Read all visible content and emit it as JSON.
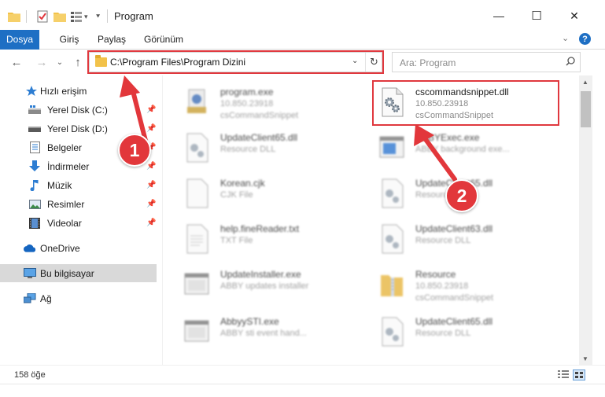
{
  "window": {
    "title": "Program",
    "minimize_glyph": "—",
    "maximize_glyph": "☐",
    "close_glyph": "✕"
  },
  "ribbon": {
    "tabs": [
      "Dosya",
      "Giriş",
      "Paylaş",
      "Görünüm"
    ],
    "active_tab": "Dosya",
    "help_glyph": "?",
    "collapse_glyph": "⌄"
  },
  "navigation": {
    "back_glyph": "←",
    "forward_glyph": "→",
    "recent_glyph": "⌄",
    "up_glyph": "↑",
    "address_path": "C:\\Program Files\\Program Dizini",
    "address_dropdown_glyph": "⌄",
    "refresh_glyph": "↻",
    "search_placeholder": "Ara: Program"
  },
  "sidebar": {
    "items": [
      {
        "label": "Hızlı erişim",
        "icon": "star-icon",
        "pinned": false
      },
      {
        "label": "Yerel Disk (C:)",
        "icon": "drive-icon",
        "pinned": true
      },
      {
        "label": "Yerel Disk (D:)",
        "icon": "drive-icon",
        "pinned": true
      },
      {
        "label": "Belgeler",
        "icon": "documents-icon",
        "pinned": true
      },
      {
        "label": "İndirmeler",
        "icon": "download-icon",
        "pinned": true
      },
      {
        "label": "Müzik",
        "icon": "music-icon",
        "pinned": true
      },
      {
        "label": "Resimler",
        "icon": "pictures-icon",
        "pinned": true
      },
      {
        "label": "Videolar",
        "icon": "video-icon",
        "pinned": true
      },
      {
        "label": "OneDrive",
        "icon": "cloud-icon",
        "pinned": false
      },
      {
        "label": "Bu bilgisayar",
        "icon": "computer-icon",
        "pinned": false
      },
      {
        "label": "Ağ",
        "icon": "network-icon",
        "pinned": false
      }
    ],
    "selected": "Bu bilgisayar"
  },
  "files": [
    {
      "name": "program.exe",
      "line2": "10.850.23918",
      "line3": "csCommandSnippet",
      "icon": "app-icon",
      "column": 0,
      "row": 0,
      "blurred": true
    },
    {
      "name": "cscommandsnippet.dll",
      "line2": "10.850.23918",
      "line3": "csCommandSnippet",
      "icon": "dll-gear-icon",
      "column": 1,
      "row": 0,
      "blurred": false
    },
    {
      "name": "UpdateClient65.dll",
      "line2": "Resource DLL",
      "line3": "",
      "icon": "dll-gear-icon",
      "column": 0,
      "row": 1,
      "blurred": true
    },
    {
      "name": "ABBYExec.exe",
      "line2": "ABBY background exe...",
      "line3": "",
      "icon": "window-app-icon",
      "column": 1,
      "row": 1,
      "blurred": true
    },
    {
      "name": "Korean.cjk",
      "line2": "CJK File",
      "line3": "",
      "icon": "blank-file-icon",
      "column": 0,
      "row": 2,
      "blurred": true
    },
    {
      "name": "UpdateClient65.dll",
      "line2": "Resource DLL",
      "line3": "",
      "icon": "dll-gear-icon",
      "column": 1,
      "row": 2,
      "blurred": true
    },
    {
      "name": "help.fineReader.txt",
      "line2": "TXT File",
      "line3": "",
      "icon": "text-file-icon",
      "column": 0,
      "row": 3,
      "blurred": true
    },
    {
      "name": "UpdateClient63.dll",
      "line2": "Resource DLL",
      "line3": "",
      "icon": "dll-gear-icon",
      "column": 1,
      "row": 3,
      "blurred": true
    },
    {
      "name": "UpdateInstaller.exe",
      "line2": "ABBY updates installer",
      "line3": "",
      "icon": "window-app-icon",
      "column": 0,
      "row": 4,
      "blurred": true
    },
    {
      "name": "Resource",
      "line2": "10.850.23918",
      "line3": "csCommandSnippet",
      "icon": "zip-folder-icon",
      "column": 1,
      "row": 4,
      "blurred": true
    },
    {
      "name": "AbbyySTI.exe",
      "line2": "ABBY sti event hand...",
      "line3": "",
      "icon": "window-app-icon",
      "column": 0,
      "row": 5,
      "blurred": true
    },
    {
      "name": "UpdateClient65.dll",
      "line2": "Resource DLL",
      "line3": "",
      "icon": "dll-gear-icon",
      "column": 1,
      "row": 5,
      "blurred": true
    }
  ],
  "status": {
    "item_count": "158 öğe"
  },
  "annotations": {
    "step1": "1",
    "step2": "2",
    "color": "#e2373b"
  }
}
